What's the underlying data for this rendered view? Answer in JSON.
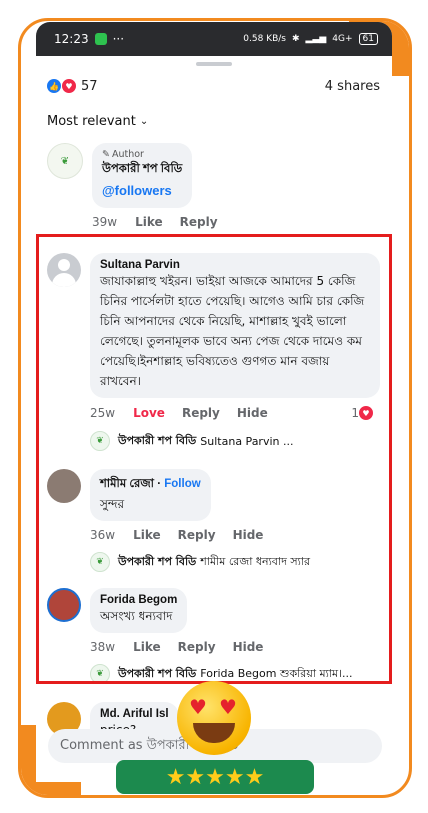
{
  "status": {
    "time": "12:23",
    "dots": "···",
    "speed": "0.58 KB/s",
    "network": "4G+",
    "battery": "61"
  },
  "reactions": {
    "count": "57",
    "shares": "4 shares"
  },
  "sort": {
    "label": "Most relevant"
  },
  "comments": [
    {
      "author_tag": "Author",
      "name": "উপকারী শপ বিডি",
      "text": "@followers",
      "time": "39w",
      "like": "Like",
      "reply": "Reply"
    },
    {
      "name": "Sultana Parvin",
      "text": "জাযাকাল্লাহু খইরন। ভাইয়া আজকে আমাদের 5 কেজি চিনির  পার্সেলটা হাতে পেয়েছি। আগেও আমি চার কেজি চিনি আপনাদের থেকে নিয়েছি, মাশাল্লাহ খুবই ভালো লেগেছে। তুলনামূলক ভাবে অন্য পেজ থেকে দামেও কম পেয়েছি।ইনশাল্লাহ ভবিষ্যতেও গুণগত মান বজায় রাখবেন।",
      "time": "25w",
      "like": "Love",
      "reply": "Reply",
      "hide": "Hide",
      "reaction_count": "1",
      "reply_from": "উপকারী শপ বিডি",
      "reply_text": "Sultana Parvin ..."
    },
    {
      "name": "শামীম রেজা",
      "follow": "Follow",
      "text": "সুন্দর",
      "time": "36w",
      "like": "Like",
      "reply": "Reply",
      "hide": "Hide",
      "reply_from": "উপকারী শপ বিডি",
      "reply_text": "শামীম রেজা ধন্যবাদ স্যার"
    },
    {
      "name": "Forida Begom",
      "text": "অসংখ্য ধন্যবাদ",
      "time": "38w",
      "like": "Like",
      "reply": "Reply",
      "hide": "Hide",
      "reply_from": "উপকারী শপ বিডি",
      "reply_text": "Forida Begom শুকরিয়া ম্যাম।..."
    },
    {
      "name": "Md. Ariful Isl",
      "text": "price?"
    }
  ],
  "composer": {
    "placeholder": "Comment as উপকারী শপ বিডি"
  },
  "rating": {
    "stars": "★★★★★"
  },
  "colors": {
    "accent": "#f28a1f",
    "highlight": "#e41d1d",
    "link": "#1877f2",
    "love": "#f02849"
  }
}
